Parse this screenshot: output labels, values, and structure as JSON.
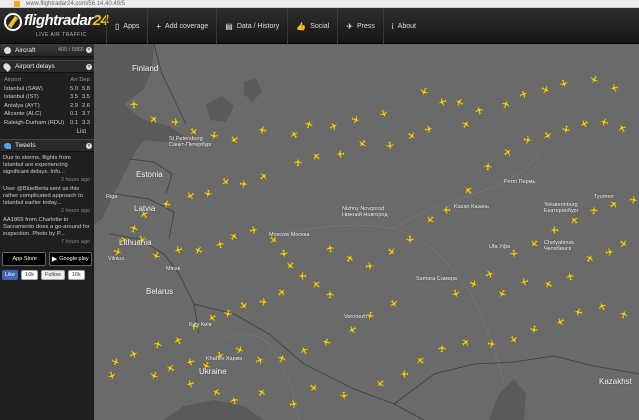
{
  "browser": {
    "url": "www.flightradar24.com/56.14,40.49/5"
  },
  "brand": {
    "name": "flightradar",
    "num": "24",
    "tagline": "LIVE AIR TRAFFIC"
  },
  "nav": [
    {
      "icon": "apps-icon",
      "glyph": "▯",
      "label": "Apps"
    },
    {
      "icon": "add-coverage-icon",
      "glyph": "+",
      "label": "Add coverage"
    },
    {
      "icon": "data-history-icon",
      "glyph": "▤",
      "label": "Data / History"
    },
    {
      "icon": "social-icon",
      "glyph": "👍",
      "label": "Social"
    },
    {
      "icon": "press-icon",
      "glyph": "✈",
      "label": "Press"
    },
    {
      "icon": "about-icon",
      "glyph": "i",
      "label": "About"
    }
  ],
  "sidebar": {
    "aircraft": {
      "label": "Aircraft",
      "count": "405 / 5865"
    },
    "airport_delays": {
      "label": "Airport delays",
      "headers": {
        "airport": "Airport",
        "arr": "Arr",
        "dep": "Dep"
      },
      "rows": [
        {
          "airport": "Istanbul (SAW)",
          "arr": "5.0",
          "dep": "5.8"
        },
        {
          "airport": "Istanbul (IST)",
          "arr": "3.5",
          "dep": "3.5"
        },
        {
          "airport": "Antalya (AYT)",
          "arr": "2.9",
          "dep": "2.6"
        },
        {
          "airport": "Alicante (ALC)",
          "arr": "0.1",
          "dep": "3.7"
        },
        {
          "airport": "Raleigh-Durham (RDU)",
          "arr": "0.1",
          "dep": "3.3"
        }
      ],
      "list_label": "List"
    },
    "tweets": {
      "label": "Tweets",
      "items": [
        {
          "text": "Due to storms, flights from Istanbul are experiencing significant delays. Info...",
          "ago": "2 hours ago"
        },
        {
          "text": "User @BlueBerta sent us this rather complicated approach to Istanbul earlier today...",
          "ago": "2 hours ago"
        },
        {
          "text": "AA1865 from Charlotte to Sacramento does a go-around for inspection. Photo by P...",
          "ago": "7 hours ago"
        }
      ]
    },
    "stores": [
      {
        "icon": "apple-icon",
        "glyph": "",
        "label": "App Store"
      },
      {
        "icon": "google-play-icon",
        "glyph": "▶",
        "label": "Google play"
      }
    ],
    "social": {
      "like": "Like",
      "like_count": "16k",
      "follow": "Follow",
      "follow_count": "16k"
    }
  },
  "map": {
    "labels": [
      {
        "text": "Finland",
        "size": "big"
      },
      {
        "text": "St Petersburg Санкт-Петербург",
        "size": "small"
      },
      {
        "text": "Estonia",
        "size": "big"
      },
      {
        "text": "Latvia",
        "size": "big"
      },
      {
        "text": "Lithuania",
        "size": "big"
      },
      {
        "text": "Belarus",
        "size": "big"
      },
      {
        "text": "Ukraine",
        "size": "big"
      },
      {
        "text": "Kazakhst",
        "size": "big"
      },
      {
        "text": "Moscow Москва",
        "size": "small"
      },
      {
        "text": "Nizhny Novgorod Нижний Новгород",
        "size": "small"
      },
      {
        "text": "Kazan Казань",
        "size": "small"
      },
      {
        "text": "Perm Пермь",
        "size": "small"
      },
      {
        "text": "Ufa Уфа",
        "size": "small"
      },
      {
        "text": "Yekaterinburg Екатеринбург",
        "size": "small"
      },
      {
        "text": "Chelyabinsk Челябинск",
        "size": "small"
      },
      {
        "text": "Samara Самара",
        "size": "small"
      },
      {
        "text": "Kyiv Київ",
        "size": "small"
      },
      {
        "text": "Kharkiv Харків",
        "size": "small"
      },
      {
        "text": "Minsk",
        "size": "small"
      },
      {
        "text": "Tyumen",
        "size": "small"
      },
      {
        "text": "Riga",
        "size": "small"
      },
      {
        "text": "Vilnius",
        "size": "small"
      },
      {
        "text": "Voronezh",
        "size": "small"
      }
    ]
  },
  "colors": {
    "map_bg": "#6c6c6c",
    "plane": "#f2d01a",
    "topbar": "#1e1e1e",
    "sidebar": "#1f1f1f"
  }
}
